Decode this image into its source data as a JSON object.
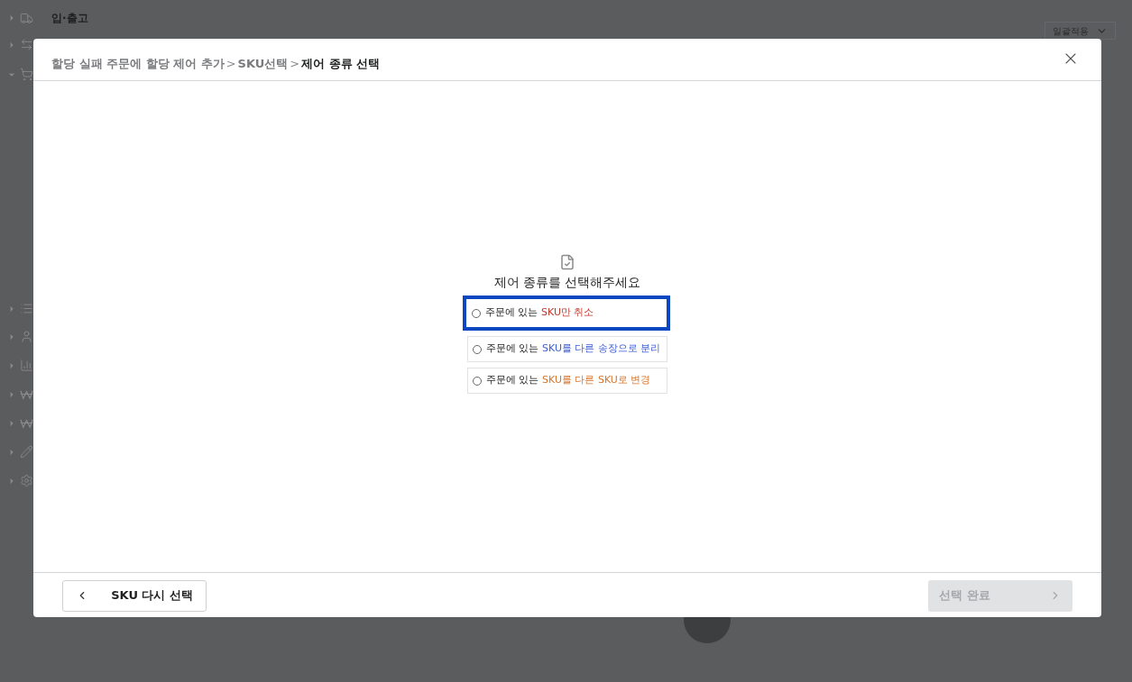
{
  "sidebar": {
    "items": [
      {
        "label": "입·출고",
        "expanded": false
      },
      {
        "expanded": false
      },
      {
        "expanded": true
      },
      {
        "expanded": false
      },
      {
        "expanded": false
      },
      {
        "expanded": false
      },
      {
        "expanded": false
      },
      {
        "expanded": false
      },
      {
        "expanded": false
      },
      {
        "expanded": false
      }
    ]
  },
  "bulk_select": {
    "value": "일괄적용"
  },
  "dialog": {
    "breadcrumb": [
      {
        "label": "할당 실패 주문에 할당 제어 추가",
        "current": false
      },
      {
        "separator": ">",
        "label": "SKU선택",
        "current": false
      },
      {
        "separator": ">",
        "label": "제어 종류 선택",
        "current": true
      }
    ],
    "prompt": "제어 종류를 선택해주세요",
    "options": [
      {
        "prefix": "주문에 있는",
        "highlight": "SKU만 취소",
        "color": "#c0392b",
        "selected": false,
        "focused": true
      },
      {
        "prefix": "주문에 있는",
        "highlight": "SKU를 다른 송장으로 분리",
        "color": "#3f5fd4",
        "selected": false,
        "focused": false
      },
      {
        "prefix": "주문에 있는",
        "highlight": "SKU를 다른 SKU로 변경",
        "color": "#d9752b",
        "selected": false,
        "focused": false
      }
    ],
    "back_button": {
      "label": "SKU 다시 선택"
    },
    "done_button": {
      "label": "선택 완료",
      "disabled": true
    }
  }
}
